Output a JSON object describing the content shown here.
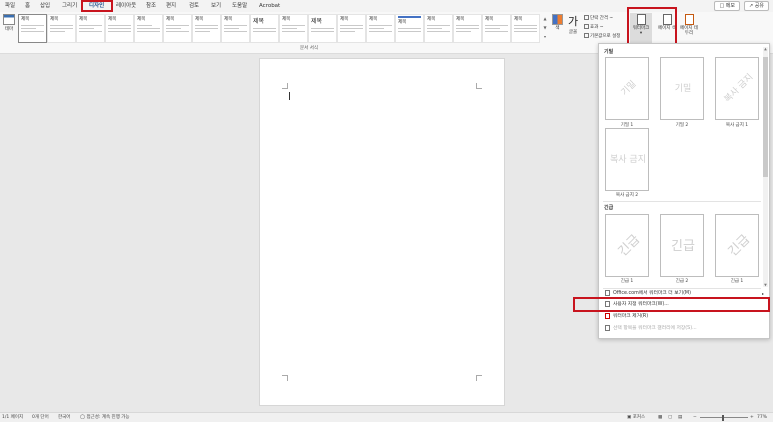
{
  "menubar": {
    "items": [
      "파일",
      "홈",
      "삽입",
      "그리기",
      "디자인",
      "레이아웃",
      "참조",
      "편지",
      "검토",
      "보기",
      "도움말",
      "Acrobat"
    ],
    "active": "디자인",
    "memo_label": "메모",
    "share_label": "공유"
  },
  "ribbon": {
    "theme_label": "테마",
    "gallery_label": "문서 서식",
    "thumb_texts": [
      "제목",
      "제목",
      "제목",
      "제목",
      "제목",
      "제목",
      "제목",
      "제목",
      "제목",
      "제목",
      "제목",
      "제목",
      "제목",
      "제목",
      "제목",
      "제목",
      "제목",
      "제목"
    ],
    "colors_label": "색",
    "fonts_glyph": "가",
    "fonts_label": "글꼴",
    "paragraph_spacing": "단락 간격 ~",
    "effects": "효과 ~",
    "set_default": "기본값으로 설정",
    "watermark_label": "워터마크",
    "page_color_label": "페이지 색",
    "page_border_label": "페이지 테두리"
  },
  "watermark_menu": {
    "section1_title": "기밀",
    "section2_title": "긴급",
    "items": [
      {
        "text": "기밀",
        "label": "기밀 1"
      },
      {
        "text": "기밀",
        "label": "기밀 2"
      },
      {
        "text": "복사 금지",
        "label": "복사 금지 1"
      },
      {
        "text": "복사 금지",
        "label": "복사 금지 2"
      },
      {
        "text": "긴급",
        "label": "긴급 1"
      },
      {
        "text": "긴급",
        "label": "긴급 2"
      },
      {
        "text": "긴급",
        "label": "긴급 1"
      }
    ],
    "more_label": "Office.com에서 워터마크 더 보기(M)",
    "custom_label": "사용자 지정 워터마크(W)...",
    "remove_label": "워터마크 제거(R)",
    "save_label": "선택 항목을 워터마크 갤러리에 저장(S)..."
  },
  "statusbar": {
    "page": "1/1 페이지",
    "words": "0개 단어",
    "language": "한국어",
    "accessibility": "접근성: 계속 진행 가능",
    "focus": "포커스",
    "zoom": "77%"
  },
  "colors": {
    "accent": "#1f4e8c",
    "highlight_box": "#c8141e"
  }
}
